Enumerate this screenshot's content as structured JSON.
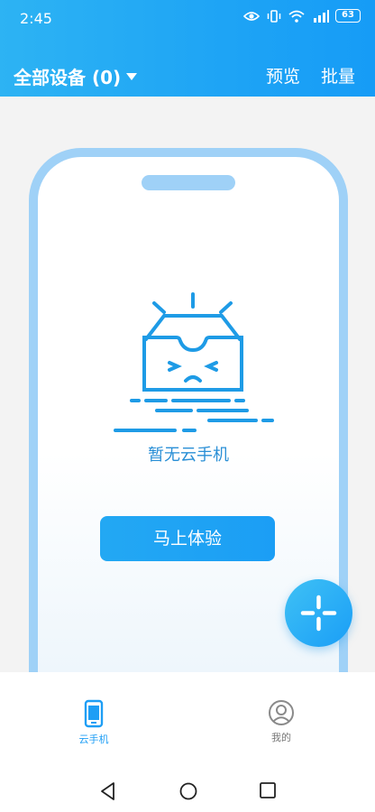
{
  "status": {
    "time": "2:45",
    "battery": "63",
    "network": "4G"
  },
  "header": {
    "device_filter": "全部设备 (0)",
    "preview": "预览",
    "batch": "批量",
    "accent": "#1ea4f5"
  },
  "main": {
    "empty_text": "暂无云手机",
    "try_button": "马上体验"
  },
  "tabs": [
    {
      "label": "云手机",
      "icon": "phone-icon",
      "active": true
    },
    {
      "label": "我的",
      "icon": "user-icon",
      "active": false
    }
  ],
  "system_nav": {
    "icons": [
      "back-icon",
      "home-icon",
      "recent-apps-icon"
    ]
  }
}
